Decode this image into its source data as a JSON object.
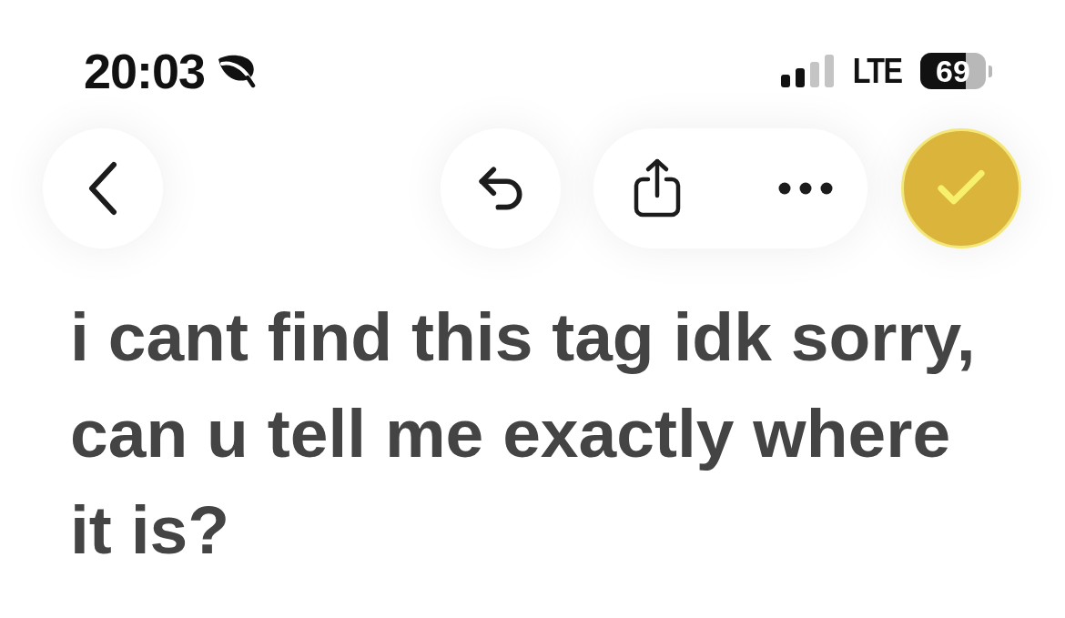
{
  "status_bar": {
    "time": "20:03",
    "network": "LTE",
    "battery": "69"
  },
  "message": {
    "text": "i cant find this tag idk sorry, can u tell me exactly where it is?"
  }
}
